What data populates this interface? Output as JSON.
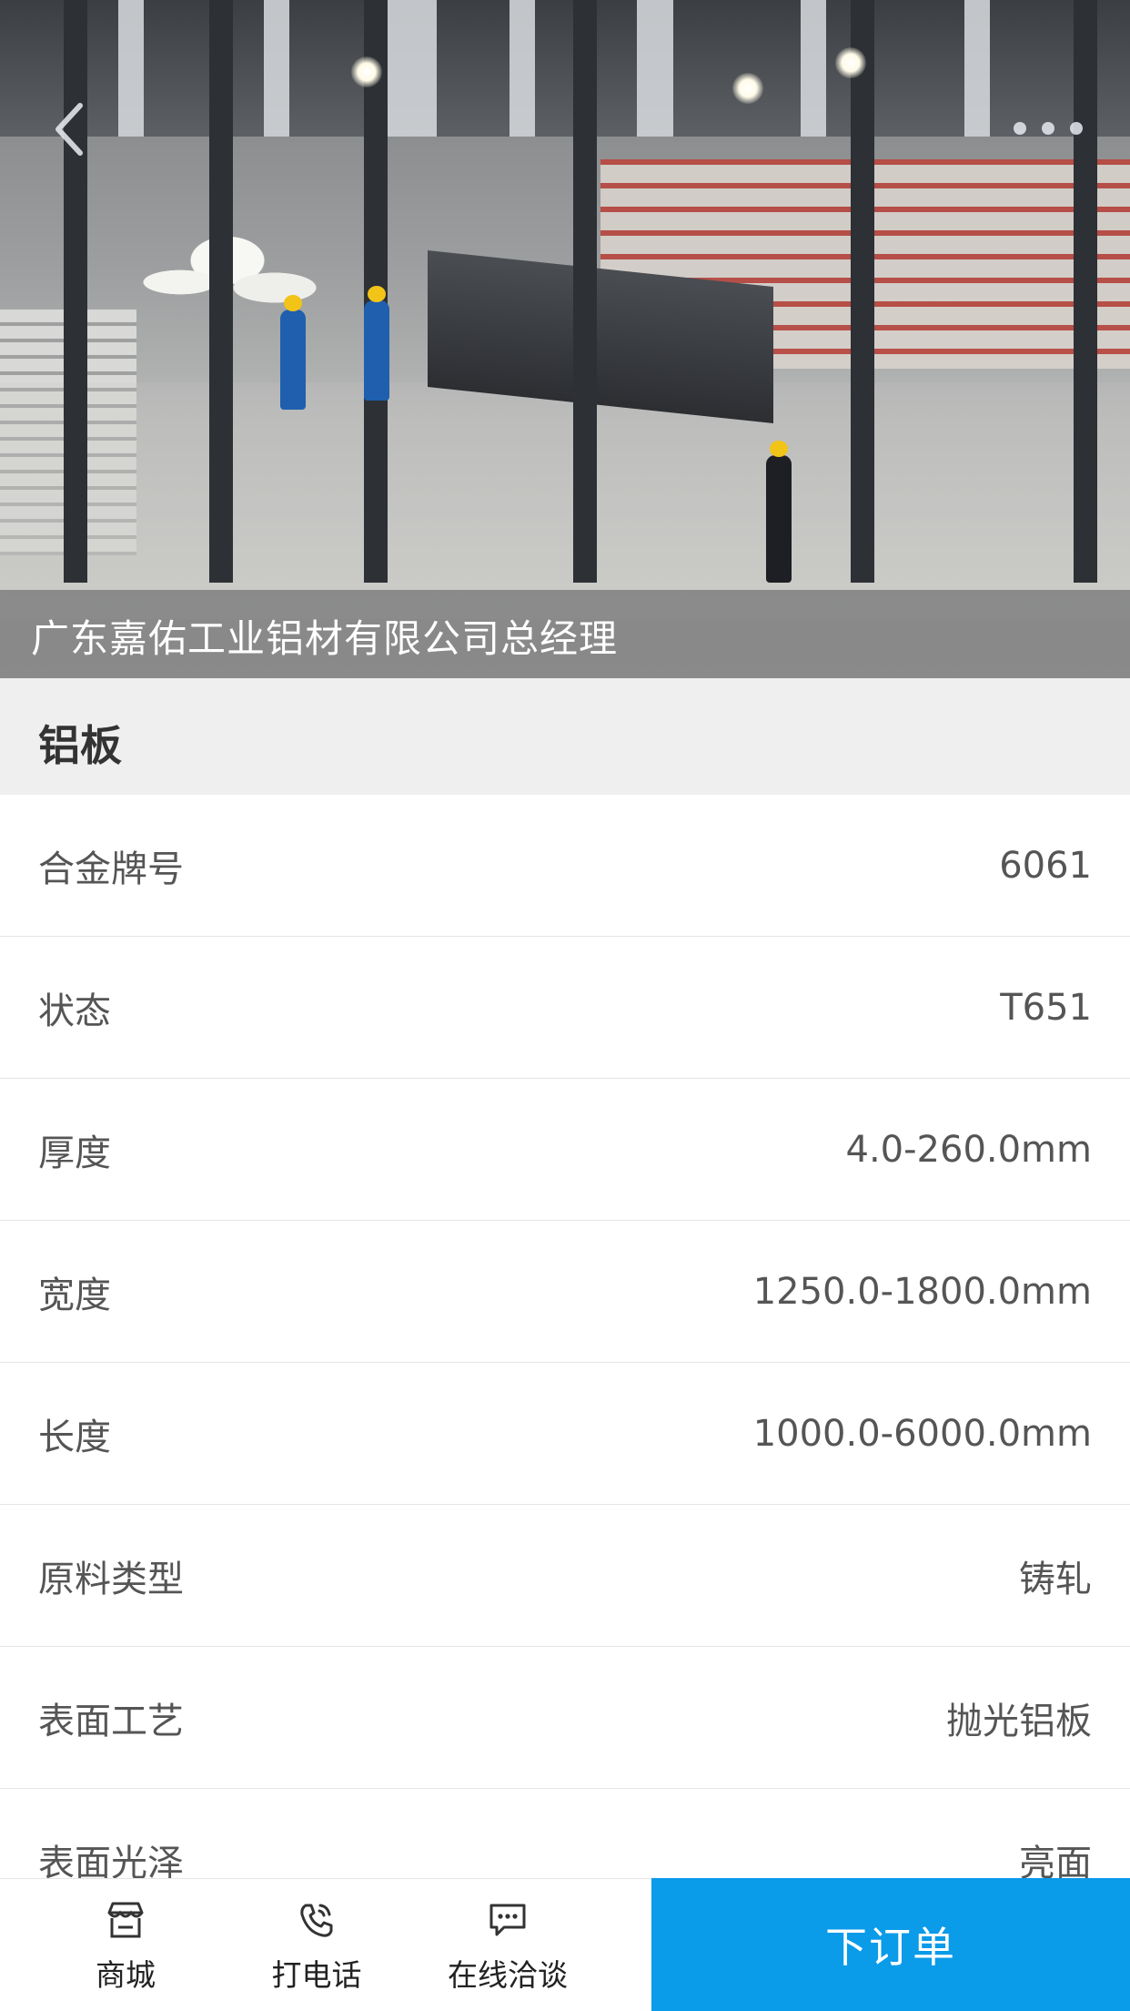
{
  "hero": {
    "caption": "广东嘉佑工业铝材有限公司总经理",
    "icons": {
      "back": "chevron-left-icon",
      "more": "more-dots-icon"
    }
  },
  "product": {
    "title": "铝板"
  },
  "specs": [
    {
      "label": "合金牌号",
      "value": "6061"
    },
    {
      "label": "状态",
      "value": "T651"
    },
    {
      "label": "厚度",
      "value": "4.0-260.0mm"
    },
    {
      "label": "宽度",
      "value": "1250.0-1800.0mm"
    },
    {
      "label": "长度",
      "value": "1000.0-6000.0mm"
    },
    {
      "label": "原料类型",
      "value": "铸轧"
    },
    {
      "label": "表面工艺",
      "value": "抛光铝板"
    },
    {
      "label": "表面光泽",
      "value": "亮面"
    }
  ],
  "bottom_bar": {
    "shop": {
      "label": "商城",
      "icon": "store-icon"
    },
    "call": {
      "label": "打电话",
      "icon": "phone-icon"
    },
    "chat": {
      "label": "在线洽谈",
      "icon": "chat-icon"
    },
    "order": {
      "label": "下订单"
    }
  },
  "colors": {
    "accent": "#0a9be9",
    "title_bg": "#efefef"
  }
}
